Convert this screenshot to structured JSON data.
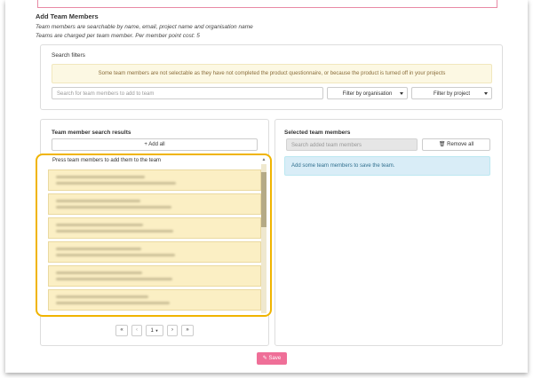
{
  "header": {
    "title": "Add Team Members",
    "subtitle_search": "Team members are searchable by name, email, project name and organisation name",
    "subtitle_charge": "Teams are charged per team member. Per member point cost: 5"
  },
  "filters": {
    "title": "Search filters",
    "warning": "Some team members are not selectable as they have not completed the product questionnaire, or because the product is turned off in your projects",
    "search_placeholder": "Search for team members to add to team",
    "org_filter_label": "Filter by organisation",
    "project_filter_label": "Filter by project"
  },
  "results": {
    "title": "Team member search results",
    "add_all_label": "+ Add all",
    "instruction": "Press team members to add them to the team",
    "member_count": 6
  },
  "selected": {
    "title": "Selected team members",
    "search_placeholder": "Search added team members",
    "remove_all_label": "Remove all",
    "empty_message": "Add some team members to save the team."
  },
  "pagination": {
    "first": "«",
    "prev": "‹",
    "current_page": "1",
    "next": "›",
    "last": "»"
  },
  "save_label": "Save",
  "colors": {
    "accent_pink": "#ef6f98",
    "highlight_yellow": "#f0b400",
    "info_blue": "#d9edf7"
  }
}
